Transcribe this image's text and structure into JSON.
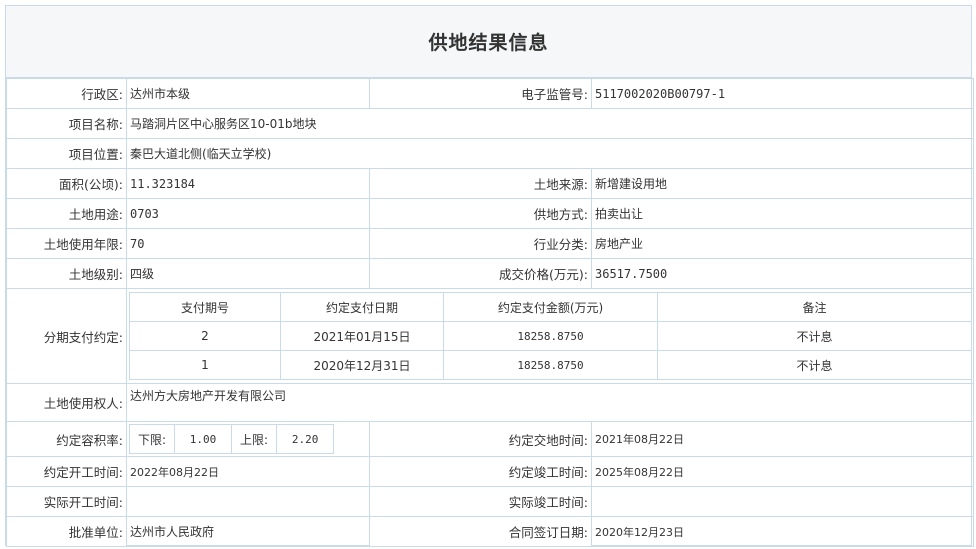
{
  "title": "供地结果信息",
  "district_label": "行政区:",
  "district_value": "达州市本级",
  "supervision_label": "电子监管号:",
  "supervision_value": "5117002020B00797-1",
  "project_name_label": "项目名称:",
  "project_name_value": "马踏洞片区中心服务区10-01b地块",
  "project_location_label": "项目位置:",
  "project_location_value": "秦巴大道北侧(临天立学校)",
  "area_label": "面积(公顷):",
  "area_value": "11.323184",
  "land_source_label": "土地来源:",
  "land_source_value": "新增建设用地",
  "land_use_label": "土地用途:",
  "land_use_value": "0703",
  "supply_method_label": "供地方式:",
  "supply_method_value": "拍卖出让",
  "use_years_label": "土地使用年限:",
  "use_years_value": "70",
  "industry_label": "行业分类:",
  "industry_value": "房地产业",
  "land_grade_label": "土地级别:",
  "land_grade_value": "四级",
  "deal_price_label": "成交价格(万元):",
  "deal_price_value": "36517.7500",
  "installment_label": "分期支付约定:",
  "installment_headers": [
    "支付期号",
    "约定支付日期",
    "约定支付金额(万元)",
    "备注"
  ],
  "installments": [
    [
      "2",
      "2021年01月15日",
      "18258.8750",
      "不计息"
    ],
    [
      "1",
      "2020年12月31日",
      "18258.8750",
      "不计息"
    ]
  ],
  "land_user_label": "土地使用权人:",
  "land_user_value": "达州方大房地产开发有限公司",
  "far_label": "约定容积率:",
  "far_lower_label": "下限:",
  "far_lower_value": "1.00",
  "far_upper_label": "上限:",
  "far_upper_value": "2.20",
  "handover_label": "约定交地时间:",
  "handover_value": "2021年08月22日",
  "start_label": "约定开工时间:",
  "start_value": "2022年08月22日",
  "complete_label": "约定竣工时间:",
  "complete_value": "2025年08月22日",
  "actual_start_label": "实际开工时间:",
  "actual_start_value": "",
  "actual_complete_label": "实际竣工时间:",
  "actual_complete_value": "",
  "approval_label": "批准单位:",
  "approval_value": "达州市人民政府",
  "contract_date_label": "合同签订日期:",
  "contract_date_value": "2020年12月23日"
}
